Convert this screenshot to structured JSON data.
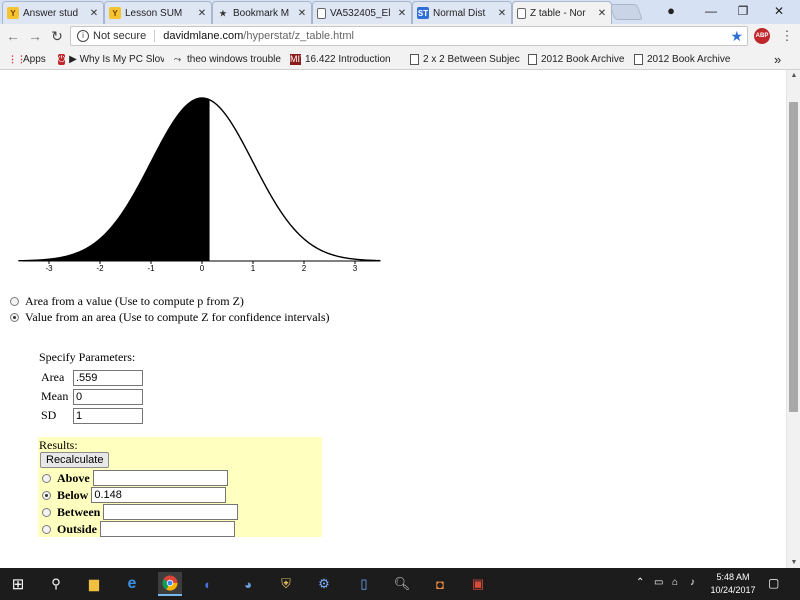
{
  "browser": {
    "tabs": [
      {
        "title": "Answer stud",
        "icon": "yahoo-answers-icon",
        "active": false
      },
      {
        "title": "Lesson SUM",
        "icon": "yahoo-answers-icon",
        "active": false
      },
      {
        "title": "Bookmark M",
        "icon": "star-icon",
        "active": false
      },
      {
        "title": "VA532405_El",
        "icon": "document-icon",
        "active": false
      },
      {
        "title": "Normal Dist",
        "icon": "st-icon",
        "active": false
      },
      {
        "title": "Z table - Nor",
        "icon": "document-icon",
        "active": true
      }
    ],
    "tab_close_glyph": "✕",
    "window_controls": {
      "minimize": "—",
      "restore": "❐",
      "close": "✕"
    },
    "address": {
      "security_label": "Not secure",
      "domain": "davidmlane.com",
      "path": "/hyperstat/z_table.html"
    },
    "bookmarks": [
      {
        "label": "Apps",
        "icon": "apps-icon"
      },
      {
        "label": "▶ Why Is My PC Slov",
        "icon": "power-icon"
      },
      {
        "label": "theo windows trouble",
        "icon": "link-icon"
      },
      {
        "label": "16.422 Introduction",
        "icon": "mit-icon"
      },
      {
        "label": "2 x 2 Between Subjec",
        "icon": "document-icon"
      },
      {
        "label": "2012 Book Archive",
        "icon": "document-icon"
      },
      {
        "label": "2012 Book Archive",
        "icon": "document-icon"
      }
    ],
    "bookmarks_overflow": "»"
  },
  "page": {
    "distribution": {
      "tick_labels": [
        "-3",
        "-2",
        "-1",
        "0",
        "1",
        "2",
        "3"
      ],
      "shaded_below_z": 0.148
    },
    "modes": [
      {
        "label": "Area from a value (Use to compute p from Z)",
        "selected": false
      },
      {
        "label": "Value from an area (Use to compute Z for confidence intervals)",
        "selected": true
      }
    ],
    "parameters": {
      "title": "Specify Parameters:",
      "area_label": "Area",
      "area_value": ".559",
      "mean_label": "Mean",
      "mean_value": "0",
      "sd_label": "SD",
      "sd_value": "1"
    },
    "results": {
      "title": "Results:",
      "recalculate_label": "Recalculate",
      "options": [
        {
          "label": "Above",
          "value": "",
          "selected": false
        },
        {
          "label": "Below",
          "value": "0.148",
          "selected": true
        },
        {
          "label": "Between",
          "value": "",
          "selected": false
        },
        {
          "label": "Outside",
          "value": "",
          "selected": false
        }
      ]
    }
  },
  "taskbar": {
    "clock_time": "5:48 AM",
    "clock_date": "10/24/2017"
  },
  "colors": {
    "tab_strip": "#d6e1f3",
    "results_bg": "#ffffc0",
    "taskbar": "#1c1c1c"
  }
}
